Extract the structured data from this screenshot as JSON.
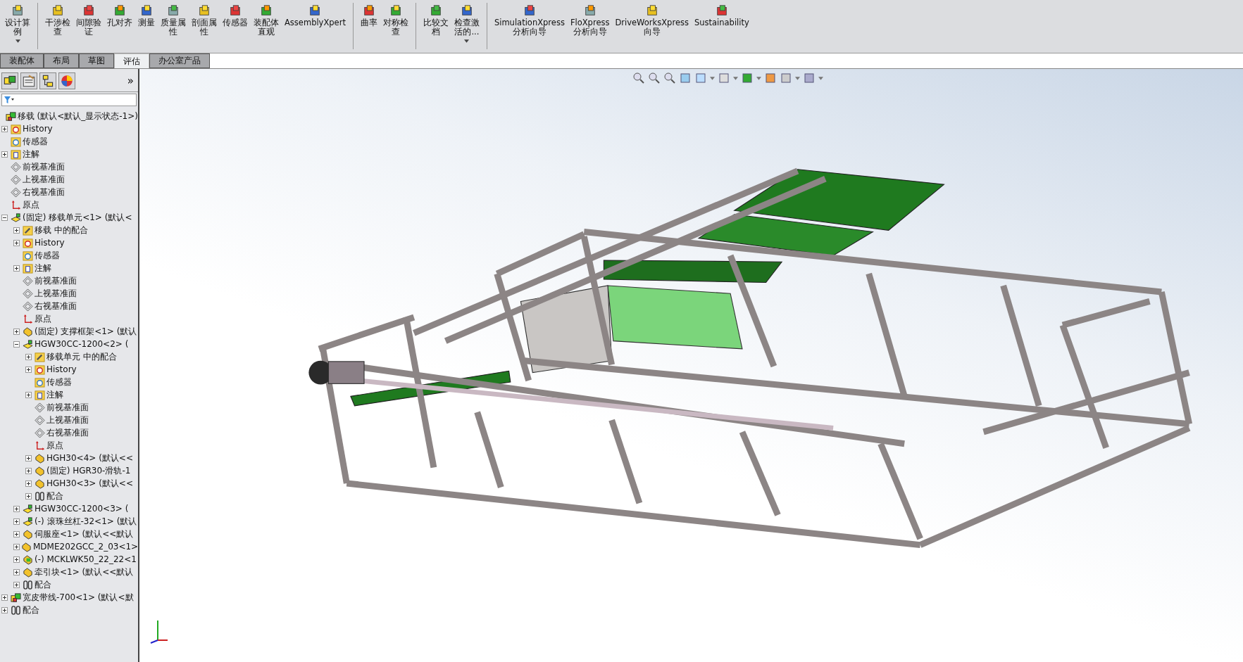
{
  "toolbar": {
    "groups": [
      [
        {
          "lines": [
            "设计算",
            "例"
          ],
          "dropdown": true
        }
      ],
      [
        {
          "lines": [
            "干涉检",
            "查"
          ],
          "dropdown": false
        },
        {
          "lines": [
            "间隙验",
            "证"
          ],
          "dropdown": false
        },
        {
          "lines": [
            "孔对齐"
          ],
          "dropdown": false
        },
        {
          "lines": [
            "测量"
          ],
          "dropdown": false
        },
        {
          "lines": [
            "质量属",
            "性"
          ],
          "dropdown": false
        },
        {
          "lines": [
            "剖面属",
            "性"
          ],
          "dropdown": false
        },
        {
          "lines": [
            "传感器"
          ],
          "dropdown": false
        },
        {
          "lines": [
            "装配体",
            "直观"
          ],
          "dropdown": false
        },
        {
          "lines": [
            "AssemblyXpert"
          ],
          "dropdown": false
        }
      ],
      [
        {
          "lines": [
            "曲率"
          ],
          "dropdown": false
        },
        {
          "lines": [
            "对称检",
            "查"
          ],
          "dropdown": false
        }
      ],
      [
        {
          "lines": [
            "比较文",
            "档"
          ],
          "dropdown": false
        },
        {
          "lines": [
            "检查激",
            "活的..."
          ],
          "dropdown": true
        }
      ],
      [
        {
          "lines": [
            "SimulationXpress",
            "分析向导"
          ],
          "dropdown": false
        },
        {
          "lines": [
            "FloXpress",
            "分析向导"
          ],
          "dropdown": false
        },
        {
          "lines": [
            "DriveWorksXpress",
            "向导"
          ],
          "dropdown": false
        },
        {
          "lines": [
            "Sustainability"
          ],
          "dropdown": false
        }
      ]
    ]
  },
  "tabs": [
    {
      "label": "装配体",
      "selected": false
    },
    {
      "label": "布局",
      "selected": false
    },
    {
      "label": "草图",
      "selected": false
    },
    {
      "label": "评估",
      "selected": true
    },
    {
      "label": "办公室产品",
      "selected": false
    }
  ],
  "panel": {
    "more": "»",
    "tree": [
      {
        "label": "移载 (默认<默认_显示状态-1>)",
        "kind": "assembly"
      },
      {
        "label": "History",
        "kind": "history",
        "expanded": false
      },
      {
        "label": "传感器",
        "kind": "sensors"
      },
      {
        "label": "注解",
        "kind": "annotations",
        "expanded": false
      },
      {
        "label": "前视基准面",
        "kind": "plane"
      },
      {
        "label": "上视基准面",
        "kind": "plane"
      },
      {
        "label": "右视基准面",
        "kind": "plane"
      },
      {
        "label": "原点",
        "kind": "origin"
      },
      {
        "label": "(固定) 移载单元<1> (默认<",
        "kind": "subassembly",
        "expanded": true,
        "children": [
          {
            "label": "移载 中的配合",
            "kind": "matefolder",
            "expanded": false
          },
          {
            "label": "History",
            "kind": "history",
            "expanded": false
          },
          {
            "label": "传感器",
            "kind": "sensors"
          },
          {
            "label": "注解",
            "kind": "annotations",
            "expanded": false
          },
          {
            "label": "前视基准面",
            "kind": "plane"
          },
          {
            "label": "上视基准面",
            "kind": "plane"
          },
          {
            "label": "右视基准面",
            "kind": "plane"
          },
          {
            "label": "原点",
            "kind": "origin"
          },
          {
            "label": "(固定) 支撑框架<1> (默认",
            "kind": "part",
            "expanded": false
          },
          {
            "label": "HGW30CC-1200<2> (",
            "kind": "subassembly",
            "expanded": true,
            "children": [
              {
                "label": "移载单元 中的配合",
                "kind": "matefolder",
                "expanded": false
              },
              {
                "label": "History",
                "kind": "history",
                "expanded": false
              },
              {
                "label": "传感器",
                "kind": "sensors"
              },
              {
                "label": "注解",
                "kind": "annotations",
                "expanded": false
              },
              {
                "label": "前视基准面",
                "kind": "plane"
              },
              {
                "label": "上视基准面",
                "kind": "plane"
              },
              {
                "label": "右视基准面",
                "kind": "plane"
              },
              {
                "label": "原点",
                "kind": "origin"
              },
              {
                "label": "HGH30<4> (默认<<",
                "kind": "part",
                "expanded": false
              },
              {
                "label": "(固定) HGR30-滑轨-1",
                "kind": "part",
                "expanded": false
              },
              {
                "label": "HGH30<3> (默认<<",
                "kind": "part",
                "expanded": false
              },
              {
                "label": "配合",
                "kind": "mates",
                "expanded": false
              }
            ]
          },
          {
            "label": "HGW30CC-1200<3> (",
            "kind": "subassembly",
            "expanded": false
          },
          {
            "label": "(-) 滚珠丝杠-32<1> (默认",
            "kind": "subassembly",
            "expanded": false
          },
          {
            "label": "伺服座<1> (默认<<默认",
            "kind": "part",
            "expanded": false
          },
          {
            "label": "MDME202GCC_2_03<1>",
            "kind": "part",
            "expanded": false
          },
          {
            "label": "(-) MCKLWK50_22_22<1",
            "kind": "toolbox",
            "expanded": false
          },
          {
            "label": "牵引块<1> (默认<<默认",
            "kind": "part",
            "expanded": false
          },
          {
            "label": "配合",
            "kind": "mates",
            "expanded": false
          }
        ]
      },
      {
        "label": "宽皮带线-700<1> (默认<默",
        "kind": "assembly",
        "expanded": false
      },
      {
        "label": "配合",
        "kind": "mates",
        "expanded": false
      }
    ]
  }
}
